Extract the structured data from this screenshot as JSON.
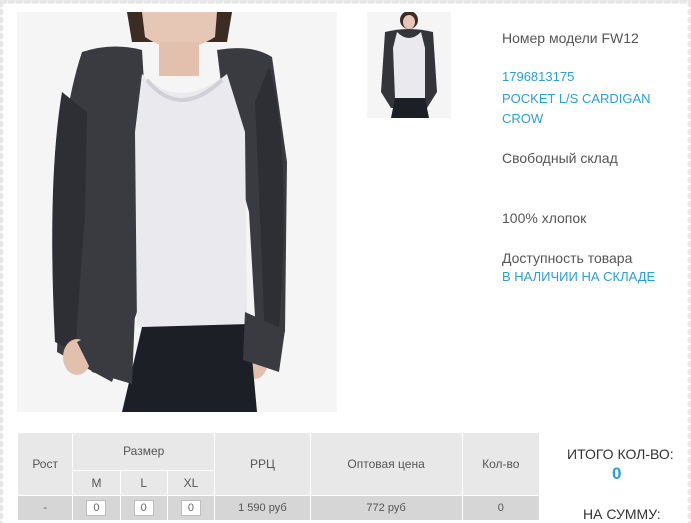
{
  "product": {
    "model_label": "Номер модели FW12",
    "code": "1796813175",
    "name": "POCKET L/S CARDIGAN CROW",
    "stock_type": "Свободный склад",
    "material": "100% хлопок",
    "availability_label": "Доступность товара",
    "availability_value": "В НАЛИЧИИ НА СКЛАДЕ"
  },
  "images": {
    "main": "product-photo",
    "thumbnail": "product-thumbnail"
  },
  "order_table": {
    "headers": {
      "height": "Рост",
      "size": "Размер",
      "sizes": [
        "M",
        "L",
        "XL"
      ],
      "rrp": "РРЦ",
      "wholesale": "Оптовая цена",
      "qty": "Кол-во"
    },
    "rows": [
      {
        "height": "-",
        "quantities": [
          "0",
          "0",
          "0"
        ],
        "rrp": "1 590 руб",
        "wholesale": "772 руб",
        "qty": "0"
      }
    ]
  },
  "totals": {
    "total_qty_label": "ИТОГО КОЛ-ВО:",
    "total_qty_value": "0",
    "sum_label": "НА СУММУ:"
  },
  "colors": {
    "link": "#2a9fd6",
    "text": "#555555",
    "table_bg": "#e8e8e8",
    "table_row": "#d6d6d6"
  }
}
